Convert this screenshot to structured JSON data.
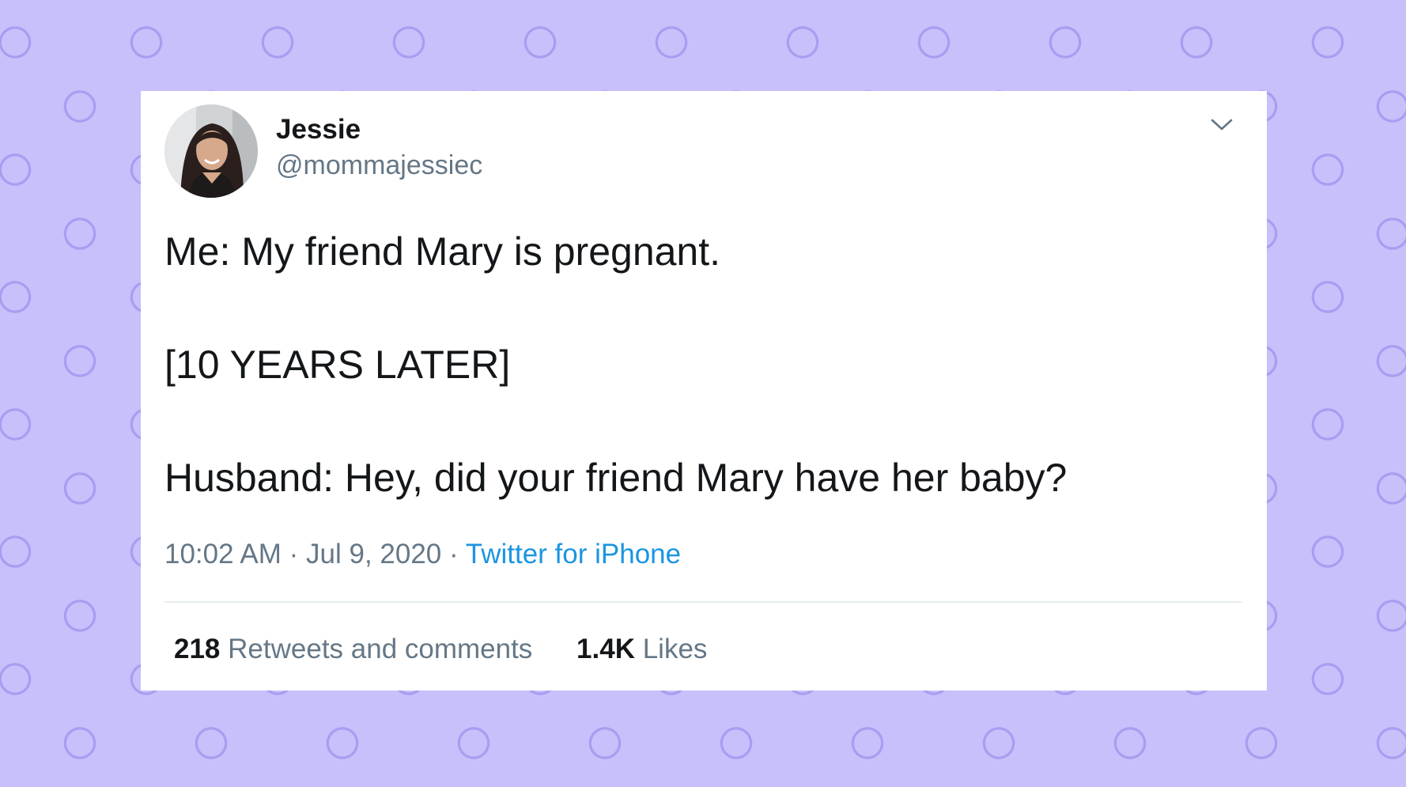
{
  "tweet": {
    "author": {
      "display_name": "Jessie",
      "handle": "@mommajessiec"
    },
    "lines": [
      "Me: My friend Mary is pregnant.",
      "[10 YEARS LATER]",
      "Husband: Hey, did your friend Mary have her baby?"
    ],
    "time": "10:02 AM",
    "separator": "·",
    "date": "Jul 9, 2020",
    "source": "Twitter for iPhone",
    "stats": {
      "retweets_count": "218",
      "retweets_label": "Retweets and comments",
      "likes_count": "1.4K",
      "likes_label": "Likes"
    }
  },
  "colors": {
    "background": "#c7c0fb",
    "circle_pattern": "#a79ef0",
    "card": "#ffffff",
    "primary_text": "#14171a",
    "secondary_text": "#657786",
    "link": "#1b95e0",
    "divider": "#e6ecf0"
  },
  "icons": {
    "caret": "chevron-down-icon",
    "avatar": "profile-photo"
  }
}
